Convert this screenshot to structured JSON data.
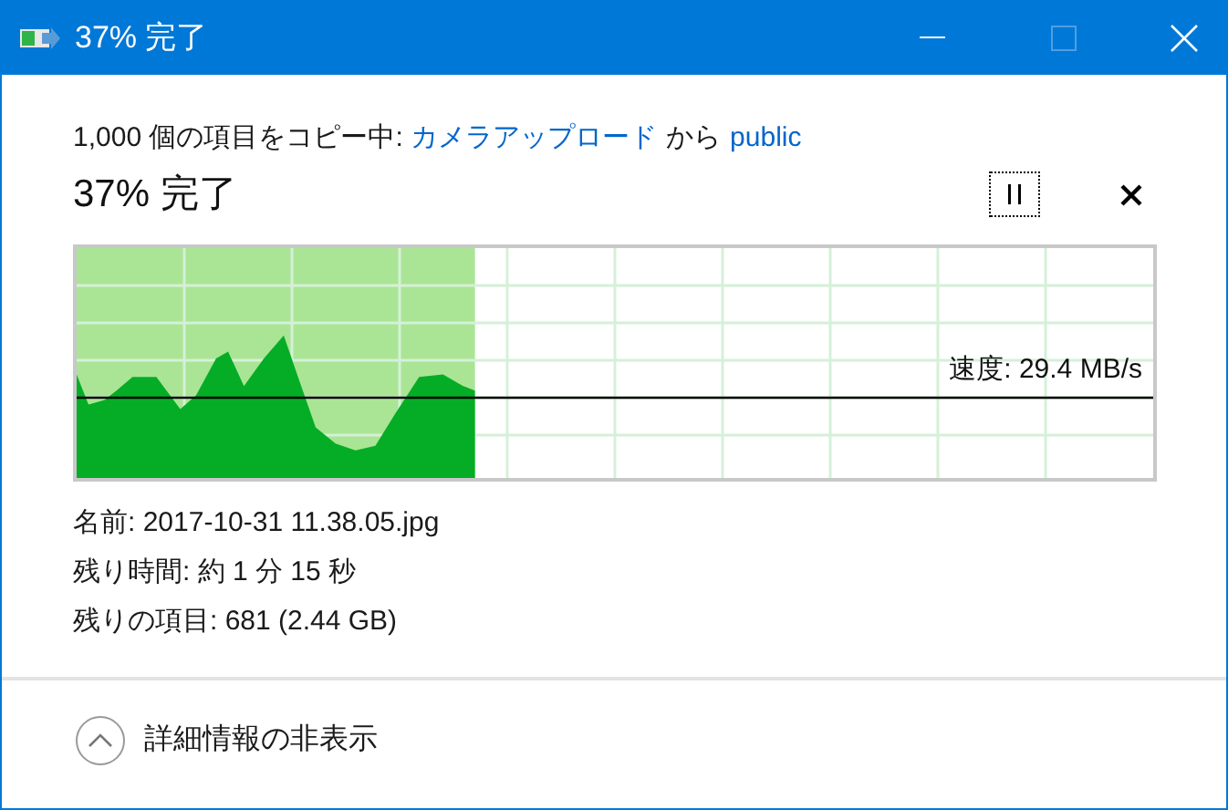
{
  "window": {
    "title": "37% 完了"
  },
  "header": {
    "prefix": "1,000 個の項目をコピー中: ",
    "source": "カメラアップロード",
    "middle": "から",
    "destination": "public"
  },
  "progress": {
    "title": "37% 完了",
    "level": 0.37,
    "speed": "速度: 29.4 MB/s"
  },
  "details": [
    "名前: 2017-10-31 11.38.05.jpg",
    "残り時間: 約 1 分 15 秒",
    "残りの項目: 681 (2.44 GB)"
  ],
  "toggle": {
    "label": "詳細情報の非表示"
  }
}
